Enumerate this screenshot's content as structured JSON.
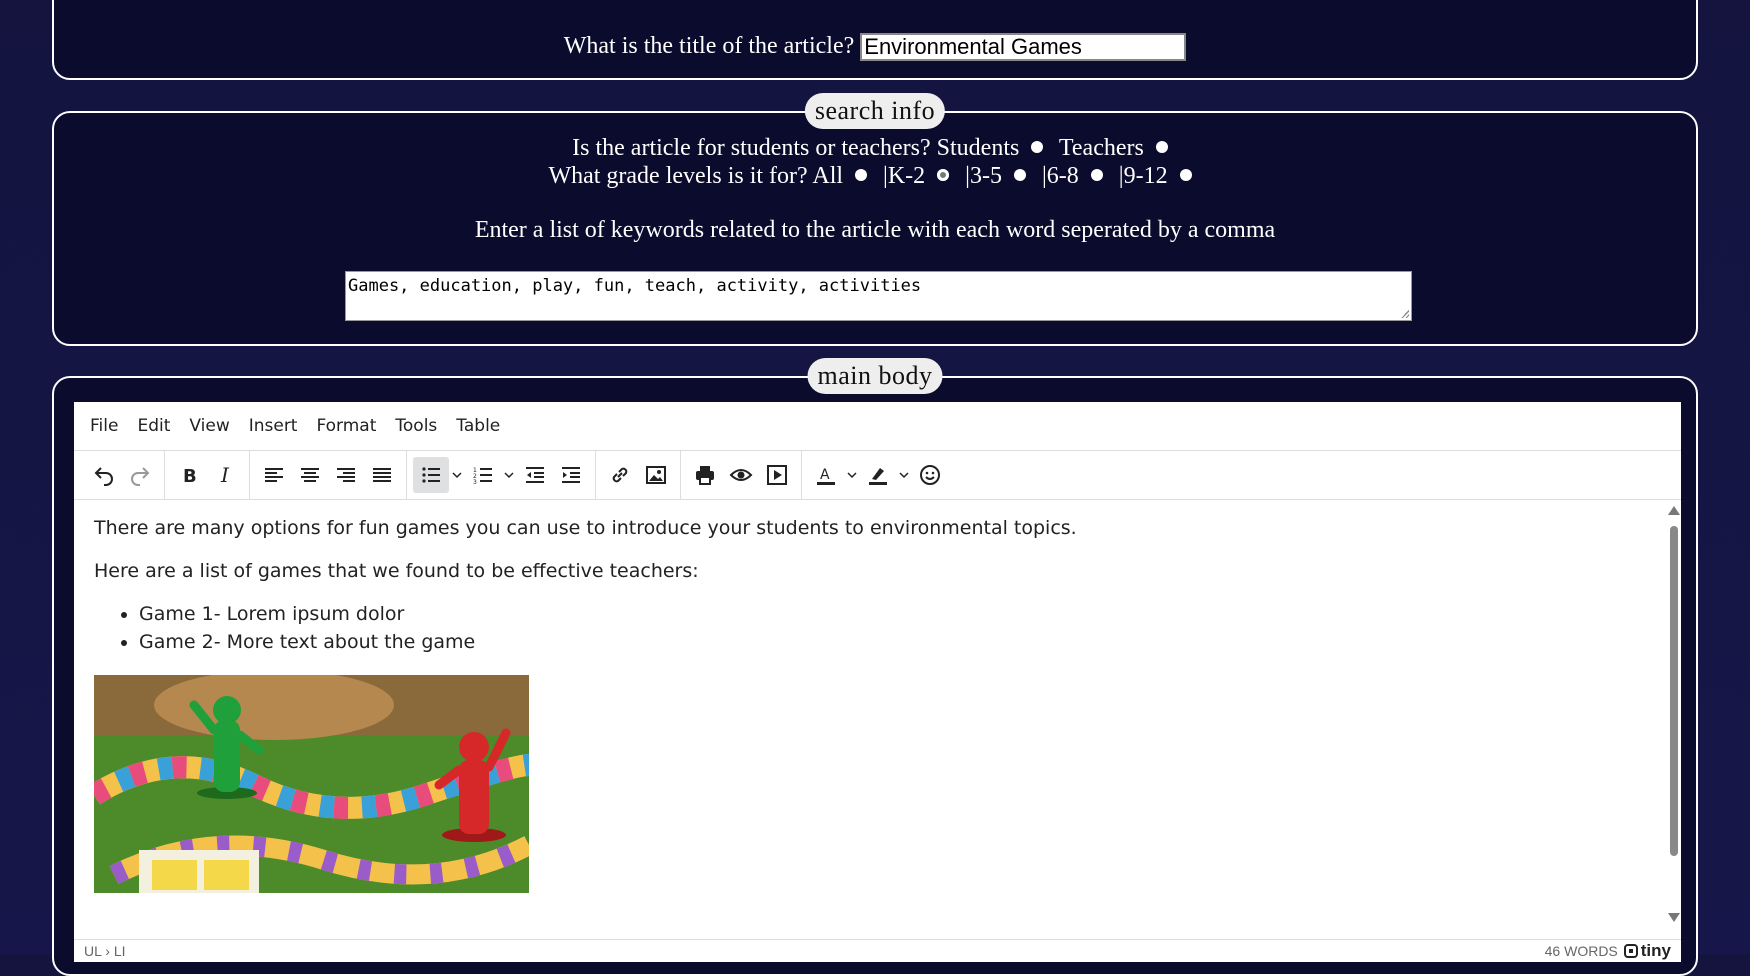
{
  "title_panel": {
    "question": "What is the title of the article?",
    "title_value": "Environmental Games"
  },
  "search_panel": {
    "legend": "search info",
    "audience_question": "Is the article for students or teachers?",
    "audience_options": [
      "Students",
      "Teachers"
    ],
    "grade_question": "What grade levels is it for?",
    "grade_options": [
      "All",
      "|K-2",
      "|3-5",
      "|6-8",
      "|9-12"
    ],
    "grade_selected": "|3-5",
    "keywords_prompt": "Enter a list of keywords related to the article with each word seperated by a comma",
    "keywords_value": "Games, education, play, fun, teach, activity, activities"
  },
  "main_panel": {
    "legend": "main body",
    "menu": [
      "File",
      "Edit",
      "View",
      "Insert",
      "Format",
      "Tools",
      "Table"
    ],
    "paragraph1": "There are many options for fun games you can use to introduce your students to environmental topics.",
    "paragraph2": "Here are a list of games that we found to be effective teachers:",
    "list_items": [
      "Game 1- Lorem ipsum dolor",
      "Game 2- More text about the game"
    ],
    "status_path": "UL › LI",
    "word_count": "46 WORDS",
    "brand": "tiny"
  }
}
